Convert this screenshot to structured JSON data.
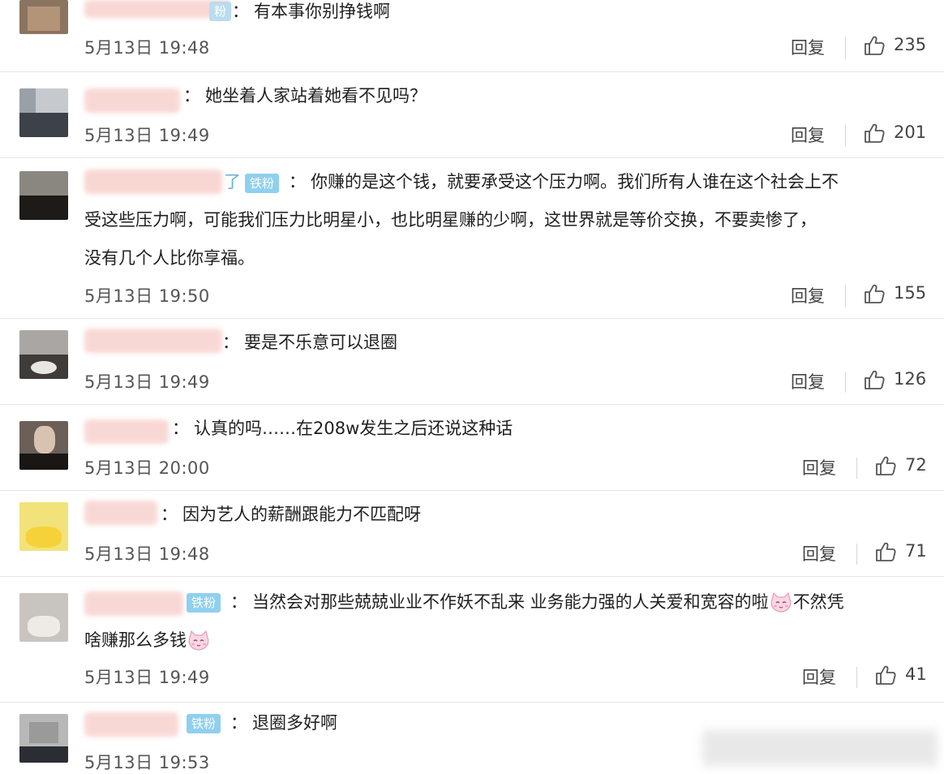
{
  "comments": [
    {
      "text": "有本事你别挣钱啊",
      "badge": "",
      "date": "5月13日 19:48",
      "reply": "回复",
      "likes": "235"
    },
    {
      "text": "她坐着人家站着她看不见吗？",
      "badge": "",
      "date": "5月13日 19:49",
      "reply": "回复",
      "likes": "201"
    },
    {
      "text_lines": [
        "你赚的是这个钱，就要承受这个压力啊。我们所有人谁在这个社会上不",
        "受这些压力啊，可能我们压力比明星小，也比明星赚的少啊，这世界就是等价交换，不要卖惨了，",
        "没有几个人比你享福。"
      ],
      "badge": "铁粉",
      "name_suffix": "了",
      "date": "5月13日 19:50",
      "reply": "回复",
      "likes": "155"
    },
    {
      "text": "要是不乐意可以退圈",
      "badge": "",
      "date": "5月13日 19:49",
      "reply": "回复",
      "likes": "126"
    },
    {
      "text": "认真的吗……在208w发生之后还说这种话",
      "badge": "",
      "date": "5月13日 20:00",
      "reply": "回复",
      "likes": "72"
    },
    {
      "text": "因为艺人的薪酬跟能力不匹配呀",
      "badge": "",
      "date": "5月13日 19:48",
      "reply": "回复",
      "likes": "71"
    },
    {
      "text_a": "当然会对那些兢兢业业不作妖不乱来 业务能力强的人关爱和宽容的啦",
      "text_b": "不然凭",
      "text_c": "啥赚那么多钱",
      "badge": "铁粉",
      "date": "5月13日 19:49",
      "reply": "回复",
      "likes": "41"
    },
    {
      "text": "退圈多好啊",
      "badge": "铁粉",
      "date": "5月13日 19:53",
      "reply": "",
      "likes": ""
    }
  ],
  "colon": "：",
  "colors": {
    "badge": "#8fd0ee",
    "separator": "#e6e6e6",
    "name_blur": "#f6c7c2"
  },
  "icons": [
    "thumbs-up-icon",
    "emoji-cat-icon"
  ]
}
